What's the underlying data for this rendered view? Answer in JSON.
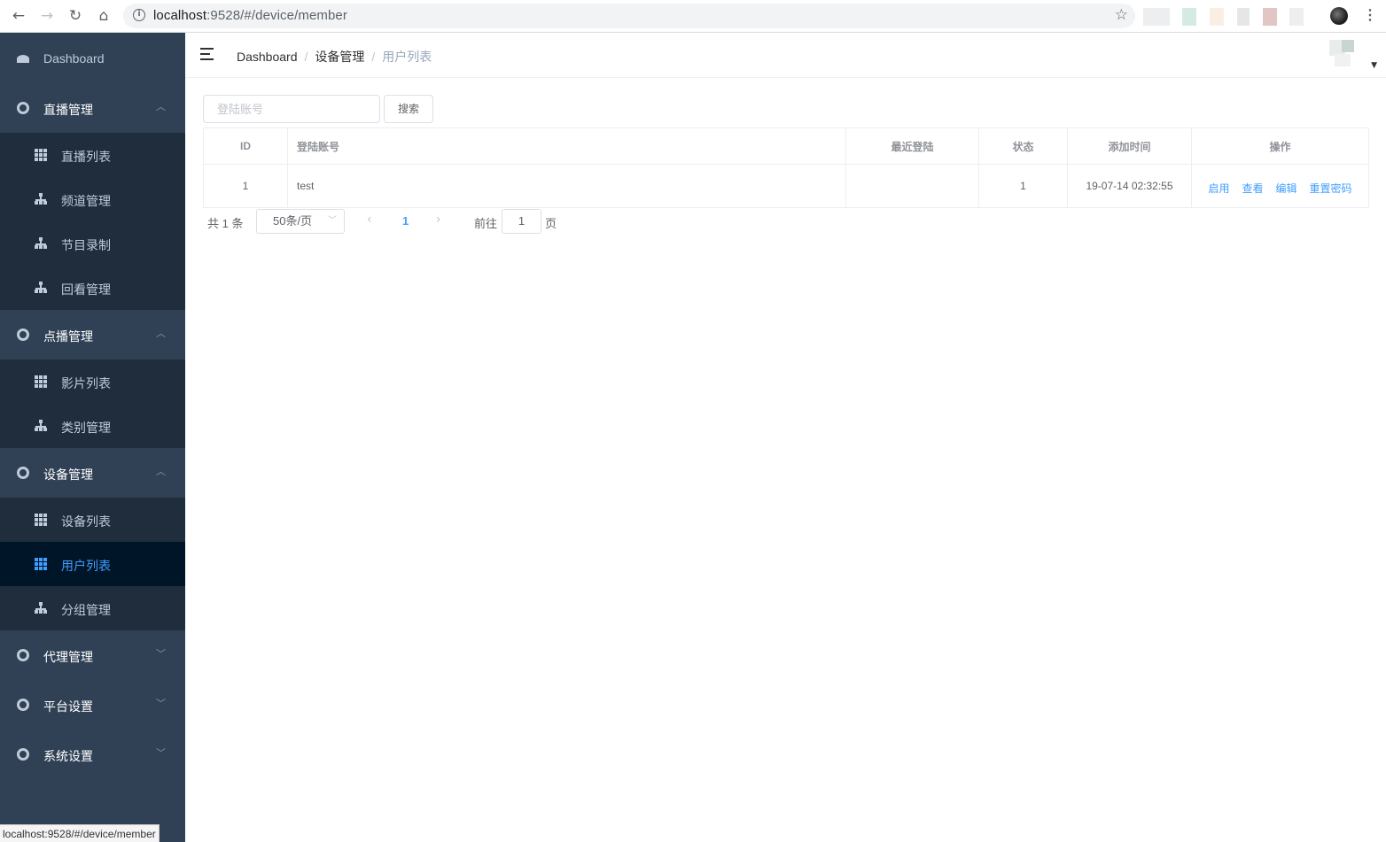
{
  "browser": {
    "url_host": "localhost",
    "url_rest": ":9528/#/device/member",
    "status_url": "localhost:9528/#/device/member"
  },
  "sidebar": {
    "dashboard": "Dashboard",
    "groups": [
      {
        "label": "直播管理",
        "expanded": true,
        "items": [
          "直播列表",
          "频道管理",
          "节目录制",
          "回看管理"
        ]
      },
      {
        "label": "点播管理",
        "expanded": true,
        "items": [
          "影片列表",
          "类别管理"
        ]
      },
      {
        "label": "设备管理",
        "expanded": true,
        "items": [
          "设备列表",
          "用户列表",
          "分组管理"
        ]
      },
      {
        "label": "代理管理",
        "expanded": false
      },
      {
        "label": "平台设置",
        "expanded": false
      },
      {
        "label": "系统设置",
        "expanded": false
      }
    ],
    "active_item": "用户列表"
  },
  "breadcrumb": [
    "Dashboard",
    "设备管理",
    "用户列表"
  ],
  "search": {
    "placeholder": "登陆账号",
    "button": "搜索"
  },
  "table": {
    "headers": [
      "ID",
      "登陆账号",
      "最近登陆",
      "状态",
      "添加时间",
      "操作"
    ],
    "rows": [
      {
        "id": "1",
        "account": "test",
        "last_login": "",
        "status": "1",
        "added": "19-07-14 02:32:55",
        "actions": [
          "启用",
          "查看",
          "编辑",
          "重置密码"
        ]
      }
    ]
  },
  "pagination": {
    "total": "共 1 条",
    "page_size": "50条/页",
    "current": "1",
    "goto_label": "前往",
    "goto_value": "1",
    "page_unit": "页"
  },
  "colors": {
    "sidebar_bg": "#304156",
    "submenu_bg": "#1f2d3d",
    "active_bg": "#001528",
    "accent": "#409eff"
  }
}
